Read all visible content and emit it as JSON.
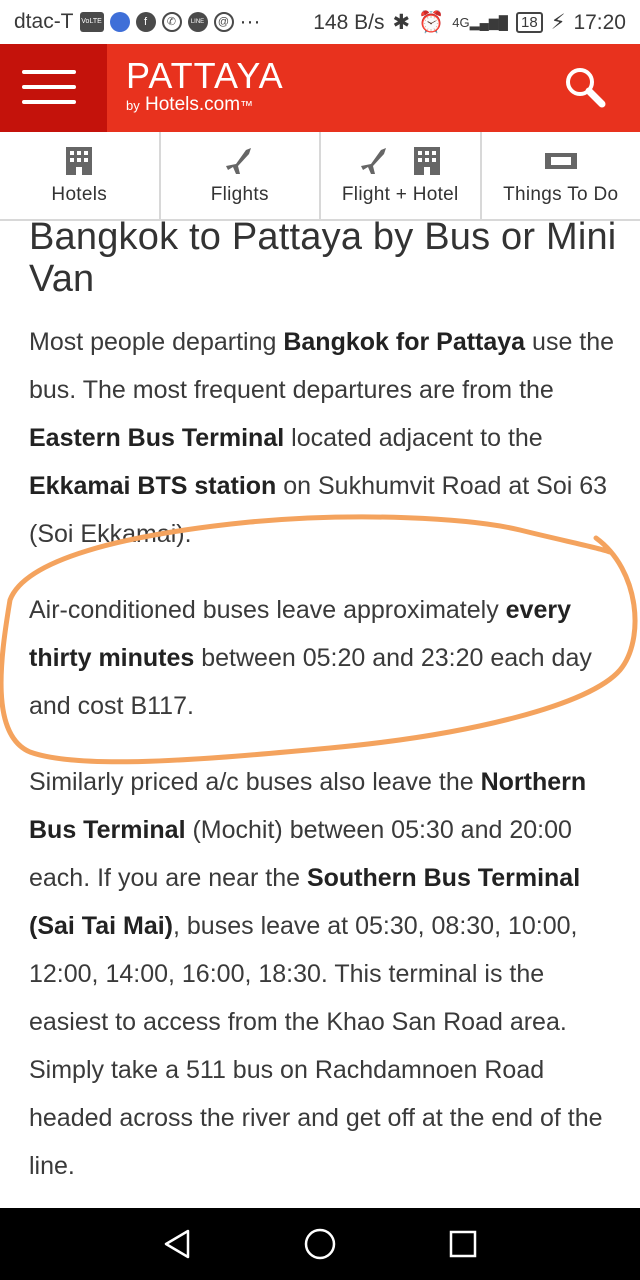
{
  "status_bar": {
    "carrier": "dtac-T",
    "volte": "VoLTE",
    "more": "···",
    "speed": "148 B/s",
    "network": "4G",
    "battery": "18",
    "time": "17:20"
  },
  "header": {
    "brand_name": "PATTAYA",
    "brand_by": "by",
    "brand_sub": "Hotels.com",
    "brand_tm": "™"
  },
  "tabs": [
    {
      "label": "Hotels"
    },
    {
      "label": "Flights"
    },
    {
      "label": "Flight + Hotel"
    },
    {
      "label": "Things To Do"
    }
  ],
  "article": {
    "title": "Bangkok to Pattaya by Bus or Mini Van",
    "p1": {
      "t1": "Most people departing ",
      "b1": "Bangkok for Pattaya",
      "t2": " use the bus. The most frequent departures are from the ",
      "b2": "Eastern Bus Terminal",
      "t3": " located adjacent to the ",
      "b3": "Ekkamai BTS station",
      "t4": " on Sukhumvit Road at Soi 63 (Soi Ekkamai)."
    },
    "p2": {
      "t1": "Air-conditioned buses leave approximately ",
      "b1": "every thirty minutes",
      "t2": " between 05:20 and 23:20 each day and cost B117."
    },
    "p3": {
      "t1": "Similarly priced a/c buses also leave the ",
      "b1": "Northern Bus Terminal",
      "t2": " (Mochit) between 05:30 and 20:00 each. If you are near the ",
      "b2": "Southern Bus Terminal (Sai Tai Mai)",
      "t3": ", buses leave at 05:30, 08:30, 10:00, 12:00, 14:00, 16:00, 18:30. This terminal is the easiest to access from the Khao San Road area. Simply take a 511 bus on Rachdamnoen Road headed across the river and get off at the end of the line."
    }
  },
  "colors": {
    "header_red": "#e8321e",
    "menu_dark_red": "#c4120b",
    "annotation_orange": "#f4a35e"
  }
}
